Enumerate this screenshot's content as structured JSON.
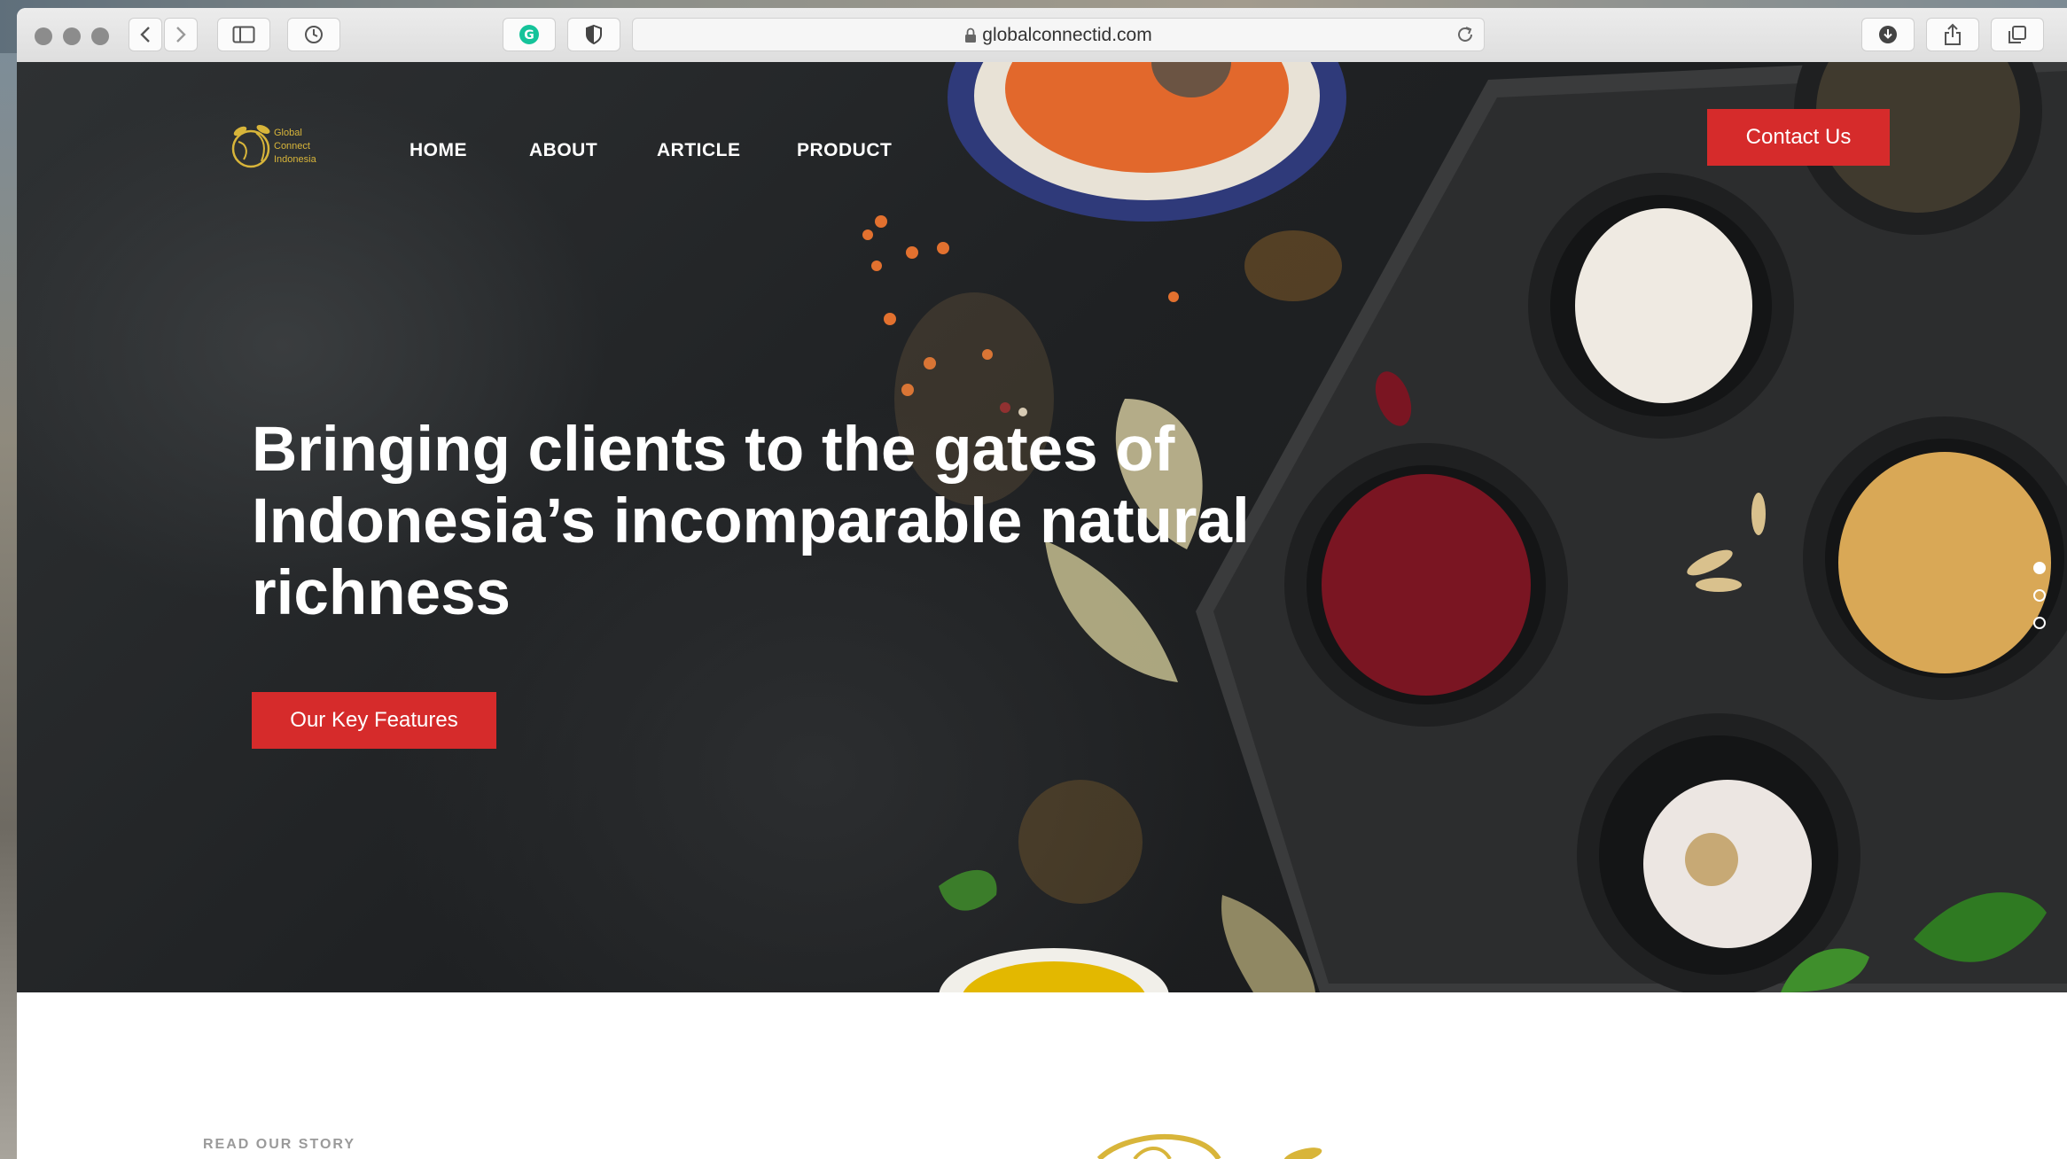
{
  "browser": {
    "url": "globalconnectid.com",
    "icons": [
      "back-icon",
      "forward-icon",
      "sidebar-icon",
      "history-icon",
      "grammarly-icon",
      "shield-icon",
      "lock-icon",
      "reload-icon",
      "download-icon",
      "share-icon",
      "tabs-icon"
    ]
  },
  "site": {
    "logo": {
      "line1": "Global",
      "line2": "Connect",
      "line3": "Indonesia"
    },
    "nav": [
      {
        "label": "HOME"
      },
      {
        "label": "ABOUT"
      },
      {
        "label": "ARTICLE"
      },
      {
        "label": "PRODUCT"
      }
    ],
    "contact_label": "Contact Us",
    "hero": {
      "headline": [
        "Bringing clients to the gates of",
        "Indonesia’s incomparable natural",
        "richness"
      ],
      "cta_label": "Our Key Features",
      "slides": [
        {
          "active": true
        },
        {
          "active": false
        },
        {
          "active": false
        }
      ]
    },
    "story_label": "READ OUR STORY"
  },
  "colors": {
    "accent": "#d62b2b",
    "logo_gold": "#d8b53a",
    "hero_bg": "#1f2123"
  }
}
